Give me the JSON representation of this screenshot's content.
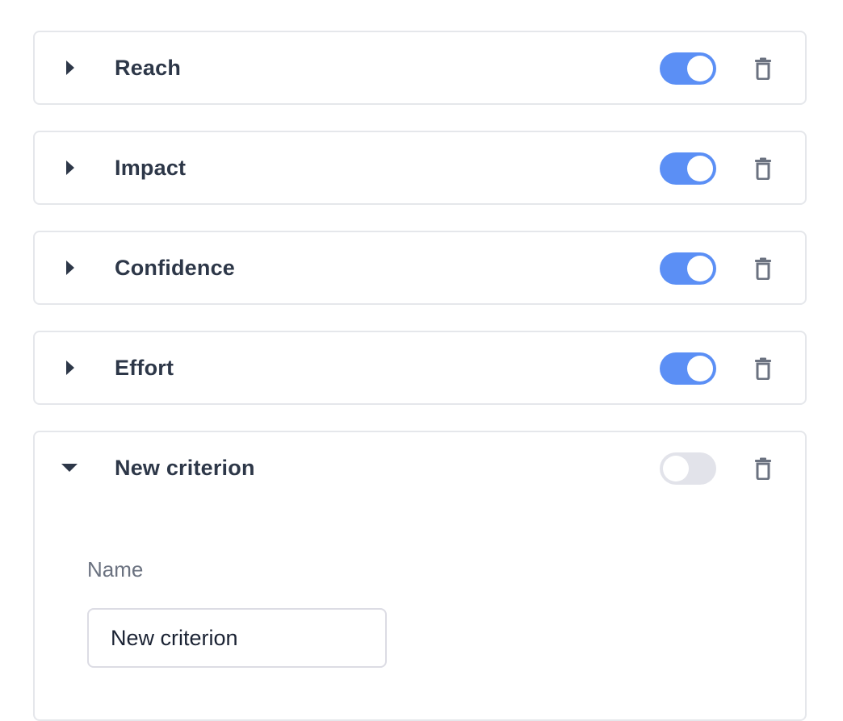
{
  "criteria": [
    {
      "label": "Reach",
      "enabled": true,
      "expanded": false
    },
    {
      "label": "Impact",
      "enabled": true,
      "expanded": false
    },
    {
      "label": "Confidence",
      "enabled": true,
      "expanded": false
    },
    {
      "label": "Effort",
      "enabled": true,
      "expanded": false
    },
    {
      "label": "New criterion",
      "enabled": false,
      "expanded": true
    }
  ],
  "expanded_form": {
    "name_label": "Name",
    "name_value": "New criterion",
    "name_placeholder": ""
  },
  "icons": {
    "collapsed": "caret-right-icon",
    "expanded": "caret-down-icon",
    "delete": "trash-icon"
  },
  "colors": {
    "toggle_on": "#5b8ff5",
    "toggle_off": "#e2e3ea",
    "title_text": "#2d3748",
    "icon_gray": "#6b7280"
  }
}
